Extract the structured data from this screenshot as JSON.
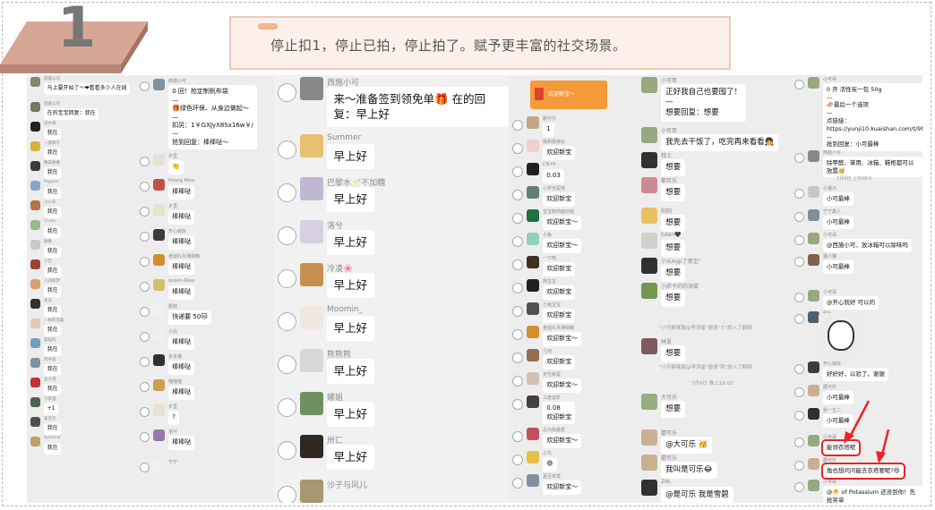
{
  "header": {
    "step_number": "1",
    "banner_text": "停止扣1，停止已拍，停止拍了。赋予更丰富的社交场景。"
  },
  "colors": {
    "accent_badge": "#d6a795",
    "banner_border": "#f0c9b6",
    "highlight": "#e22222",
    "red_packet": "#f59a3a"
  },
  "chat": {
    "col1": {
      "messages": [
        {
          "name": "酒菌公司",
          "text": "马上要开始了～❤看看多少人在线",
          "avatar": "#7a8a6a"
        },
        {
          "name": "酒菌公司",
          "text": "在的宝宝回复：我在",
          "avatar": "#6f7b60"
        },
        {
          "name": "日中来",
          "text": "我在",
          "avatar": "#222"
        },
        {
          "name": "一醉解千",
          "text": "我在",
          "avatar": "#d8b040"
        },
        {
          "name": "晚安故事",
          "text": "我在",
          "avatar": "#3c3c3c"
        },
        {
          "name": "Poppen",
          "text": "我在",
          "avatar": "#89a8c8"
        },
        {
          "name": "小小乐",
          "text": "我在",
          "avatar": "#b87048"
        },
        {
          "name": "Cheer",
          "text": "我在",
          "avatar": "#98b888"
        },
        {
          "name": "静静",
          "text": "我在",
          "avatar": "#c8c8c8"
        },
        {
          "name": "小哲",
          "text": "我在",
          "avatar": "#a04030"
        },
        {
          "name": "人间如梦",
          "text": "我在",
          "avatar": "#d8a070"
        },
        {
          "name": "冬天",
          "text": "我在",
          "avatar": "#303030"
        },
        {
          "name": "一样的温柔",
          "text": "我在",
          "avatar": "#e0c8b0"
        },
        {
          "name": "猫猫的",
          "text": "我在",
          "avatar": "#70a0c0"
        },
        {
          "name": "风中追",
          "text": "我在",
          "avatar": "#8090a0"
        },
        {
          "name": "豆大叔",
          "text": "我在",
          "avatar": "#c03030"
        },
        {
          "name": "小笨蛋",
          "text": "+1",
          "avatar": "#506050"
        },
        {
          "name": "安宝贝",
          "text": "我在",
          "avatar": "#505050"
        },
        {
          "name": "Summer",
          "text": "我在",
          "avatar": "#c0a060"
        }
      ]
    },
    "col2": {
      "messages": [
        {
          "name": "西施小可",
          "text": "0 回！抢定制帆布袋\n—\n🎁绿色环保、从身边做起～\n—\n扣另：1￥GXJyX8Sx16w￥/\n—\n抢到回复：棒棒哒～",
          "avatar": "#8090a8"
        },
        {
          "name": "乡里",
          "text": "👏",
          "avatar": "#e8e0d0"
        },
        {
          "name": "Hoang Nina",
          "text": "棒棒哒",
          "avatar": "#c05050"
        },
        {
          "name": "乡里",
          "text": "棒棒哒",
          "avatar": "#e8e0d0"
        },
        {
          "name": "开心就好",
          "text": "棒棒哒",
          "avatar": "#403840"
        },
        {
          "name": "老姐红月薄荷精",
          "text": "棒棒哒",
          "avatar": "#d09030"
        },
        {
          "name": "queen-Rose",
          "text": "棒棒哒",
          "avatar": "#d0c070"
        },
        {
          "name": "蘑菇",
          "text": "快递要 50🐱",
          "avatar": "#f0f0f0"
        },
        {
          "name": "小白",
          "text": "棒棒哒",
          "avatar": "#f0f0f0"
        },
        {
          "name": "多多猫",
          "text": "棒棒哒",
          "avatar": "#303030"
        },
        {
          "name": "喵喵喵",
          "text": "棒棒哒",
          "avatar": "#c8a050"
        },
        {
          "name": "乡里",
          "text": "?",
          "avatar": "#e8e0d0"
        },
        {
          "name": "洛兮",
          "text": "棒棒哒",
          "avatar": "#9878a8"
        },
        {
          "name": "宁宁",
          "text": "",
          "avatar": "#f0f0f0"
        }
      ]
    },
    "col3": {
      "messages": [
        {
          "name": "西施小可",
          "text": "来～准备签到领免单🎁 在的回复：早上好",
          "avatar": "#888"
        },
        {
          "name": "Summer",
          "text": "早上好",
          "avatar": "#e8c070"
        },
        {
          "name": "巴黎水🥂不加糖",
          "text": "早上好",
          "avatar": "#c0b8d0"
        },
        {
          "name": "洛兮",
          "text": "早上好",
          "avatar": "#d8d0e0"
        },
        {
          "name": "冷凌🌸",
          "text": "早上好",
          "avatar": "#c89050"
        },
        {
          "name": "Moomin_",
          "text": "早上好",
          "avatar": "#f0e8e0"
        },
        {
          "name": "熊熊熊",
          "text": "早上好",
          "avatar": "#d8d8d8"
        },
        {
          "name": "娜姐",
          "text": "早上好",
          "avatar": "#709060"
        },
        {
          "name": "卅匸",
          "text": "早上好",
          "avatar": "#302820"
        },
        {
          "name": "沙子与风儿",
          "text": "",
          "avatar": "#a89870"
        }
      ]
    },
    "col4": {
      "red_packet_label": "欢迎新宝～",
      "messages": [
        {
          "name": "木头",
          "text": "",
          "avatar": "#607050"
        },
        {
          "name": "蘑可乐",
          "text": "1",
          "avatar": "#c0a888"
        },
        {
          "name": "我和我来玩",
          "text": "欢迎新宝",
          "avatar": "#f0d0d0"
        },
        {
          "name": "CN-Hi",
          "text": "0.03",
          "avatar": "#202020"
        },
        {
          "name": "小样也是吧",
          "text": "欢迎新宝",
          "avatar": "#608070"
        },
        {
          "name": "宝宝和你面对面",
          "text": "欢迎新宝～",
          "avatar": "#207040"
        },
        {
          "name": "小兔",
          "text": "欢迎新宝～",
          "avatar": "#90d0c0"
        },
        {
          "name": "一只鸭",
          "text": "欢迎新宝",
          "avatar": "#403020"
        },
        {
          "name": "熊宝宝",
          "text": "欢迎新宝",
          "avatar": "#202020"
        },
        {
          "name": "小兔宝宝",
          "text": "欢迎新宝",
          "avatar": "#505050"
        },
        {
          "name": "老姐红月薄荷精",
          "text": "欢迎新宝～",
          "avatar": "#d09030"
        },
        {
          "name": "几何",
          "text": "欢迎新宝",
          "avatar": "#907050"
        },
        {
          "name": "天生就是",
          "text": "欢迎新宝～",
          "avatar": "#d0c0b0"
        },
        {
          "name": "三度音阶",
          "text": "0.08\n欢迎新宝",
          "avatar": "#404040"
        },
        {
          "name": "近为我最爱",
          "text": "欢迎新宝～",
          "avatar": "#c05060"
        },
        {
          "name": "小鸟",
          "text": "😄",
          "avatar": "#e8c040"
        },
        {
          "name": "夏至末草",
          "text": "欢迎新宝～",
          "avatar": "#8090a0"
        }
      ]
    },
    "col5": {
      "system_join_1": "\"小可群客服@李添星\"邀请\"Ⓢ\"加入了群聊",
      "system_join_2": "\"小可群客服@李添星\"邀请\"我\"加入了群聊",
      "timestamp": "7月9日 晚上19:02",
      "messages": [
        {
          "name": "小可哥",
          "text": "正好我自己也要囤了！\n—\n想要回复：想要",
          "avatar": "#98a880"
        },
        {
          "name": "小可哥",
          "text": "我先去干饭了，吃完再来看看👧",
          "avatar": "#98a880"
        },
        {
          "name": "桃土",
          "text": "想要",
          "avatar": "#303030"
        },
        {
          "name": "都可乐",
          "text": "想要",
          "avatar": "#d08890"
        },
        {
          "name": "阳阳",
          "text": "想要",
          "avatar": "#e8c060"
        },
        {
          "name": "Eden🖤",
          "text": "想要",
          "avatar": "#d0d0d0"
        },
        {
          "name": "小从Agp了蛋宝ᵕ̈",
          "text": "想要",
          "avatar": "#303030"
        },
        {
          "name": "小胖子的的海棠",
          "text": "想要",
          "avatar": "#709850"
        },
        {
          "name": "林夏",
          "text": "想要",
          "avatar": "#805860"
        },
        {
          "name": "大可乐",
          "text": "想要",
          "avatar": "#90b080"
        },
        {
          "name": "蘑可乐",
          "text": "@大可乐 🥳",
          "avatar": "#c8b090"
        },
        {
          "name": "蘑可乐",
          "text": "我叫是可乐😂",
          "avatar": "#c8b090"
        },
        {
          "name": "Z6L",
          "text": "@是可乐 我是雪碧",
          "avatar": "#303030"
        }
      ]
    },
    "col6": {
      "timestamp": "7月9日 上午09:5",
      "messages": [
        {
          "name": "小可哥",
          "text": "0 开 活性炭一包 50g\n—\n🛷最后一个选项\n—\n点链接：https://yunji10.kuaishan.com/t/9NFxPj\n—\n抢到回复：小可最棒",
          "avatar": "#98a880"
        },
        {
          "name": "西施小可",
          "text": "除甲醛、苯用、冰箱、鞋柜都可以放置🥳",
          "avatar": "#888"
        },
        {
          "name": "小猫爪",
          "text": "小可最棒",
          "avatar": "#c0c8d0"
        },
        {
          "name": "宁宁鑫人",
          "text": "小可最棒",
          "avatar": "#809098"
        },
        {
          "name": "小可哥",
          "text": "@西施小可、放冰箱可以除味吗",
          "avatar": "#98a880"
        },
        {
          "name": "猫小猫",
          "text": "小可最棒",
          "avatar": "#806050"
        },
        {
          "name": "小可哥",
          "text": "@开心就好 可以的",
          "avatar": "#98a880"
        },
        {
          "name": "照片",
          "text": "",
          "avatar": "#506070"
        },
        {
          "name": "开心就好",
          "text": "好好好，以验了。谢谢",
          "avatar": "#403840"
        },
        {
          "name": "蘑可乐",
          "text": "小可最棒",
          "avatar": "#c8b090"
        },
        {
          "name": "我一生二",
          "text": "小可最棒",
          "avatar": "#303030"
        },
        {
          "name": "小可哥",
          "text": "能领衣塔呢",
          "avatar": "#98a880"
        },
        {
          "name": "蘑可乐",
          "text": "角也想问问能去衣塔要呢?😄",
          "avatar": "#c8b090"
        },
        {
          "name": "小可哥",
          "text": "@🐣 of Potassium 还没到你！先抢奖单",
          "avatar": "#98a880"
        }
      ]
    }
  }
}
